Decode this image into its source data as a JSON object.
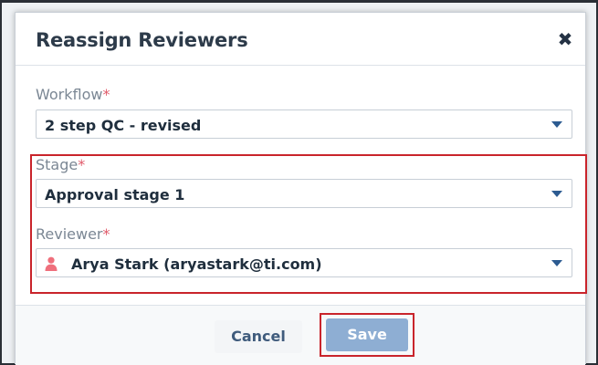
{
  "dialog": {
    "title": "Reassign Reviewers",
    "close_label": "✖"
  },
  "fields": {
    "workflow": {
      "label": "Workflow",
      "required_mark": "*",
      "value": "2 step QC - revised"
    },
    "stage": {
      "label": "Stage",
      "required_mark": "*",
      "value": "Approval stage 1"
    },
    "reviewer": {
      "label": "Reviewer",
      "required_mark": "*",
      "value": "Arya Stark (aryastark@ti.com)",
      "icon": "person-icon"
    }
  },
  "buttons": {
    "cancel": "Cancel",
    "save": "Save"
  },
  "colors": {
    "highlight": "#c9242b",
    "required": "#e05a6a",
    "save_button": "#8eaed3",
    "caret": "#2c5b91"
  }
}
